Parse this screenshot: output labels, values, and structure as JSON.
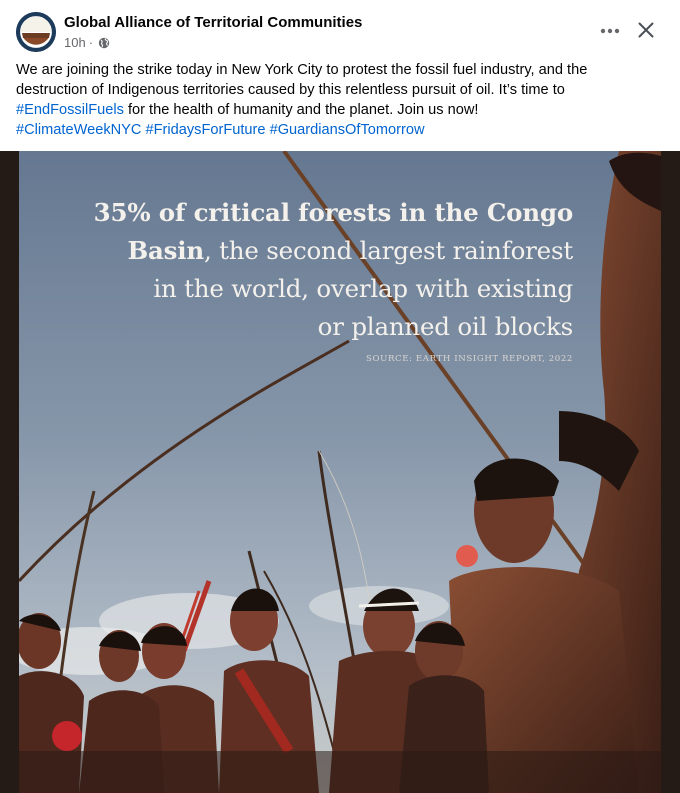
{
  "post": {
    "page_name": "Global Alliance of Territorial Communities",
    "time": "10h",
    "separator": "·",
    "privacy_icon": "globe-icon",
    "more_icon": "ellipsis-icon",
    "close_icon": "close-icon",
    "text": {
      "line1": "We are joining the strike today in New York City to protest the fossil fuel industry, and the",
      "line2": "destruction of Indigenous territories caused by this relentless pursuit of oil. It’s time to",
      "line3_hashtag": "#EndFossilFuels",
      "line3_rest": " for the health of humanity and the planet. Join us now!",
      "hashtags": [
        "#ClimateWeekNYC",
        "#FridaysForFuture",
        "#GuardiansOfTomorrow"
      ]
    }
  },
  "image": {
    "headline_bold1": "35% of critical forests in the Congo",
    "headline_bold2": "Basin",
    "headline_rest2": ", the second largest rainforest",
    "headline_line3": "in the world, overlap with existing",
    "headline_line4": "or planned oil blocks",
    "source": "SOURCE: EARTH INSIGHT REPORT, 2022"
  },
  "colors": {
    "link": "#0064d1",
    "secondary_text": "#65676b",
    "sky_top": "#6d7f96",
    "sky_bottom": "#aab6c2"
  }
}
